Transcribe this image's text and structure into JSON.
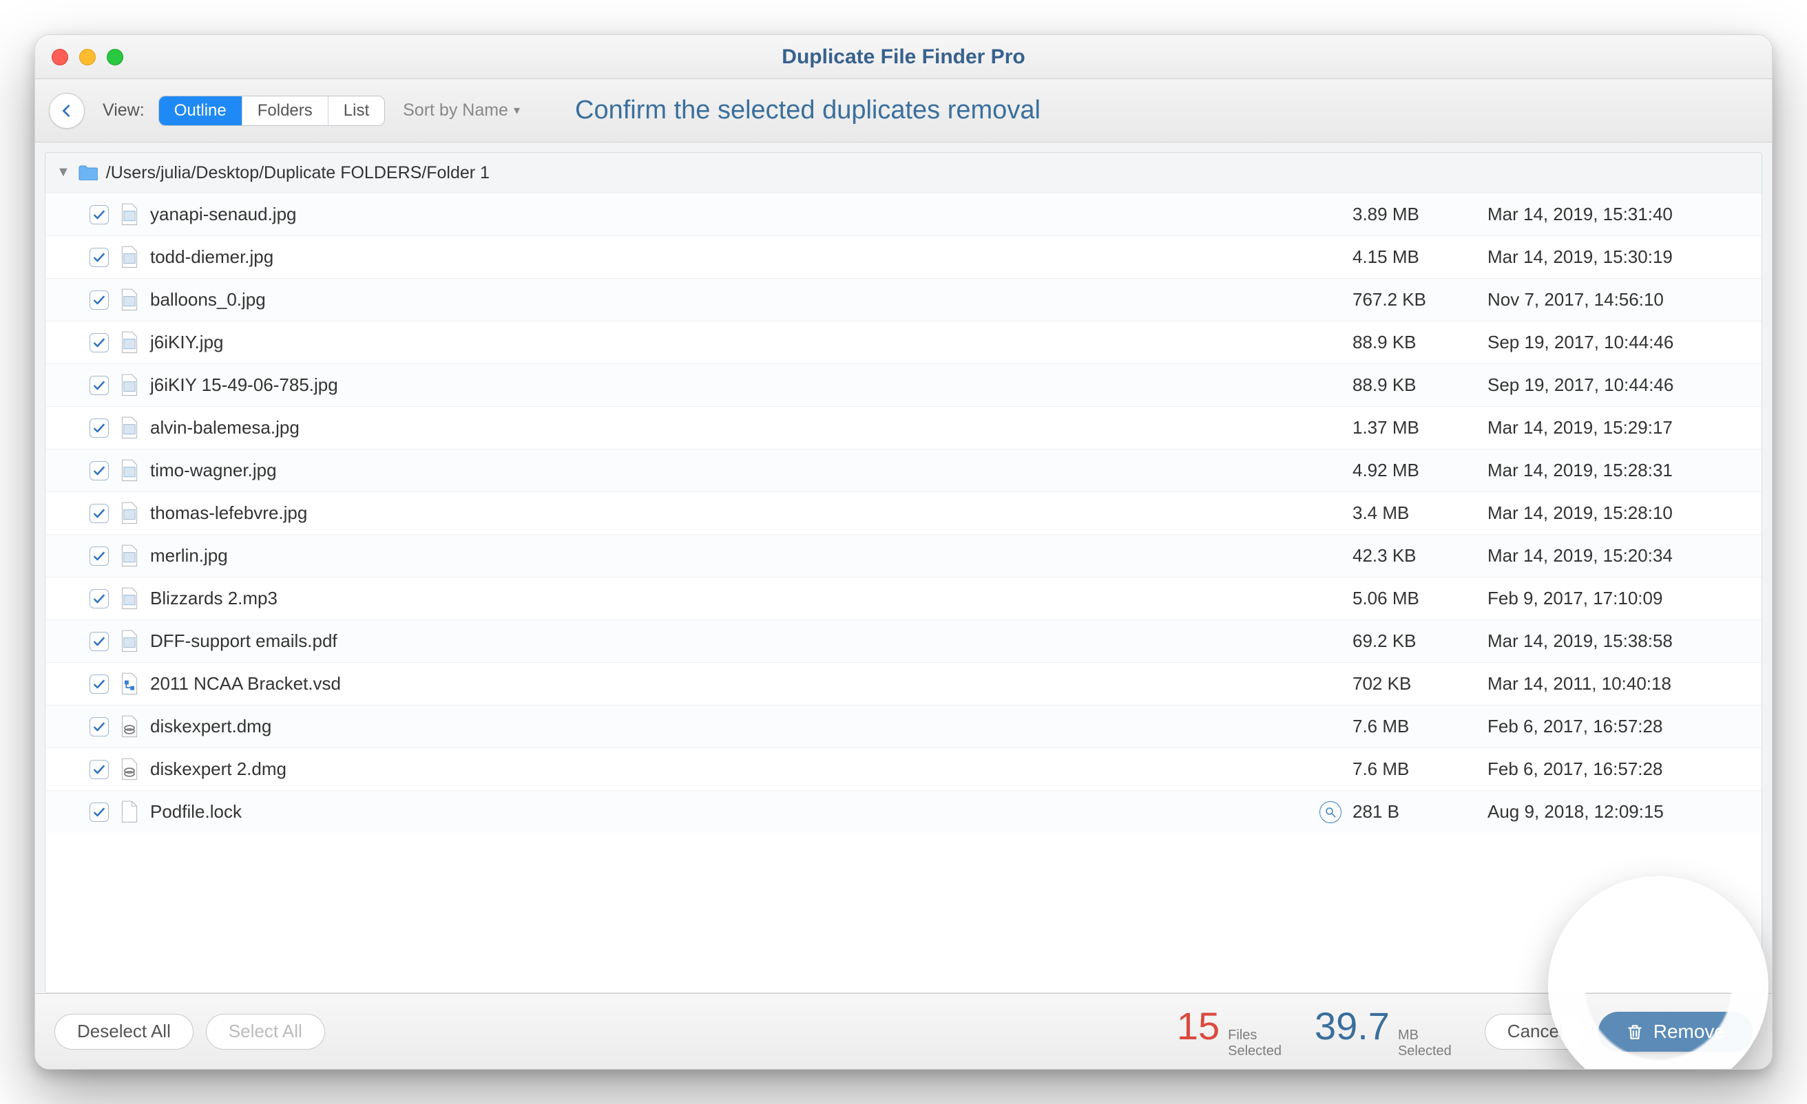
{
  "titlebar": {
    "title": "Duplicate File Finder Pro"
  },
  "toolbar": {
    "view_label": "View:",
    "seg": {
      "outline": "Outline",
      "folders": "Folders",
      "list": "List"
    },
    "sort_label": "Sort by Name",
    "subtitle": "Confirm the selected duplicates removal"
  },
  "group": {
    "path": "/Users/julia/Desktop/Duplicate FOLDERS/Folder 1"
  },
  "rows": [
    {
      "name": "yanapi-senaud.jpg",
      "size": "3.89 MB",
      "date": "Mar 14, 2019, 15:31:40",
      "type": "image"
    },
    {
      "name": "todd-diemer.jpg",
      "size": "4.15 MB",
      "date": "Mar 14, 2019, 15:30:19",
      "type": "image"
    },
    {
      "name": "balloons_0.jpg",
      "size": "767.2 KB",
      "date": "Nov 7, 2017, 14:56:10",
      "type": "image"
    },
    {
      "name": "j6iKIY.jpg",
      "size": "88.9 KB",
      "date": "Sep 19, 2017, 10:44:46",
      "type": "image"
    },
    {
      "name": "j6iKIY 15-49-06-785.jpg",
      "size": "88.9 KB",
      "date": "Sep 19, 2017, 10:44:46",
      "type": "image"
    },
    {
      "name": "alvin-balemesa.jpg",
      "size": "1.37 MB",
      "date": "Mar 14, 2019, 15:29:17",
      "type": "image"
    },
    {
      "name": "timo-wagner.jpg",
      "size": "4.92 MB",
      "date": "Mar 14, 2019, 15:28:31",
      "type": "image"
    },
    {
      "name": "thomas-lefebvre.jpg",
      "size": "3.4 MB",
      "date": "Mar 14, 2019, 15:28:10",
      "type": "image"
    },
    {
      "name": "merlin.jpg",
      "size": "42.3 KB",
      "date": "Mar 14, 2019, 15:20:34",
      "type": "image"
    },
    {
      "name": "Blizzards 2.mp3",
      "size": "5.06 MB",
      "date": "Feb 9, 2017, 17:10:09",
      "type": "audio"
    },
    {
      "name": "DFF-support emails.pdf",
      "size": "69.2 KB",
      "date": "Mar 14, 2019, 15:38:58",
      "type": "pdf"
    },
    {
      "name": "2011 NCAA Bracket.vsd",
      "size": "702 KB",
      "date": "Mar 14, 2011, 10:40:18",
      "type": "vsd"
    },
    {
      "name": "diskexpert.dmg",
      "size": "7.6 MB",
      "date": "Feb 6, 2017, 16:57:28",
      "type": "dmg"
    },
    {
      "name": "diskexpert 2.dmg",
      "size": "7.6 MB",
      "date": "Feb 6, 2017, 16:57:28",
      "type": "dmg"
    },
    {
      "name": "Podfile.lock",
      "size": "281 B",
      "date": "Aug 9, 2018, 12:09:15",
      "type": "generic",
      "magnify": true
    }
  ],
  "footer": {
    "deselect": "Deselect All",
    "select": "Select All",
    "files_count": "15",
    "files_label1": "Files",
    "files_label2": "Selected",
    "size_count": "39.7",
    "size_label1": "MB",
    "size_label2": "Selected",
    "cancel": "Cancel",
    "remove": "Remove"
  }
}
